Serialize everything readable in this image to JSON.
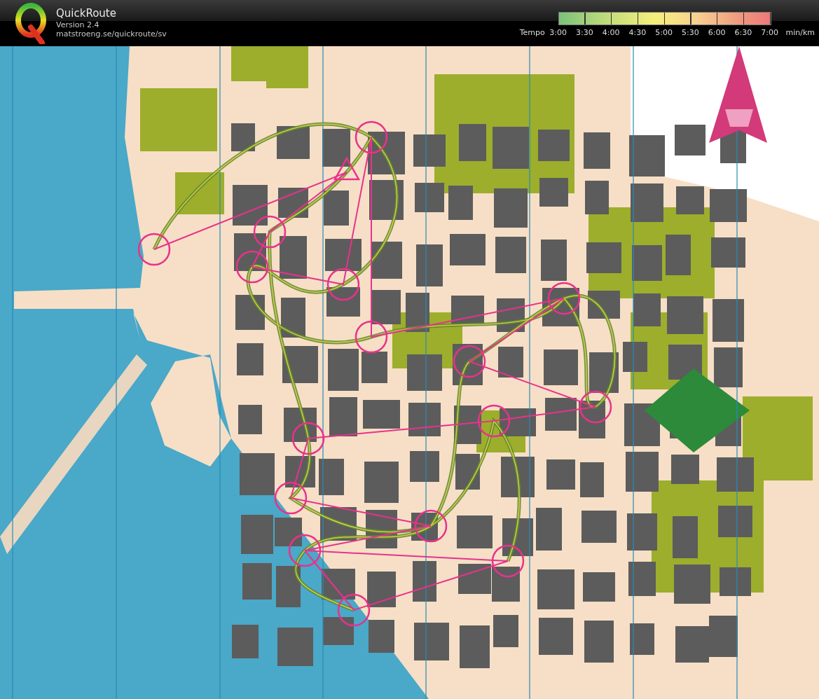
{
  "app": {
    "title": "QuickRoute",
    "version": "Version 2.4",
    "url": "matstroeng.se/quickroute/sv"
  },
  "tempo_legend": {
    "label": "Tempo",
    "ticks": [
      "3:00",
      "3:30",
      "4:00",
      "4:30",
      "5:00",
      "5:30",
      "6:00",
      "6:30",
      "7:00"
    ],
    "unit": "min/km"
  }
}
